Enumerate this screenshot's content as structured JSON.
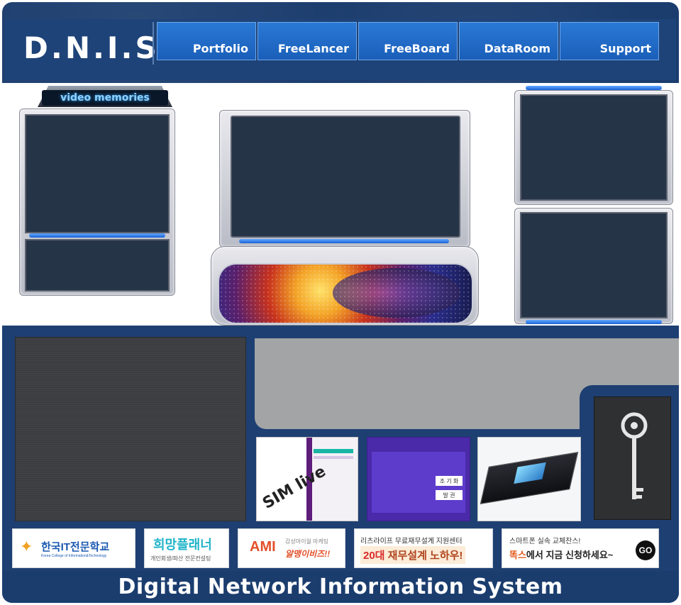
{
  "header": {
    "logo": "D.N.I.S",
    "nav": [
      {
        "label": "Portfolio"
      },
      {
        "label": "FreeLancer"
      },
      {
        "label": "FreeBoard"
      },
      {
        "label": "DataRoom"
      },
      {
        "label": "Support"
      }
    ]
  },
  "video": {
    "title": "video memories"
  },
  "thumbnails": [
    {
      "name": "simlive-brochure",
      "text": "SIM live"
    },
    {
      "name": "finance-form",
      "text": "조 기 화"
    },
    {
      "name": "chip",
      "text": ""
    },
    {
      "name": "key",
      "text": ""
    }
  ],
  "form_thumb": {
    "cell1": "조 기 화",
    "cell2": "발 권"
  },
  "banners": [
    {
      "title": "한국IT전문학교",
      "subtitle": "Korea College of Information&Technology"
    },
    {
      "title": "희망플래너",
      "subtitle": "개인회생/파산 전문컨설팅"
    },
    {
      "title": "AMI",
      "line1": "감성마이월 마케팅",
      "line2": "알맹이비즈!!"
    },
    {
      "line1": "리츠라이프 무료재무설계 지원센터",
      "line2a": "20대",
      "line2b": " 재무설계 노하우!"
    },
    {
      "line1": "스마트폰 실속 교체찬스!",
      "line2a": "똑스",
      "line2b": "에서 지금 신청하세요~",
      "go": "GO"
    }
  ],
  "footer": {
    "title": "Digital Network Information System"
  },
  "colors": {
    "header_bg": "#1b3d6e",
    "nav_blue": "#1a5fb9",
    "screen": "#263447",
    "accent_blue": "#1a63d6"
  }
}
